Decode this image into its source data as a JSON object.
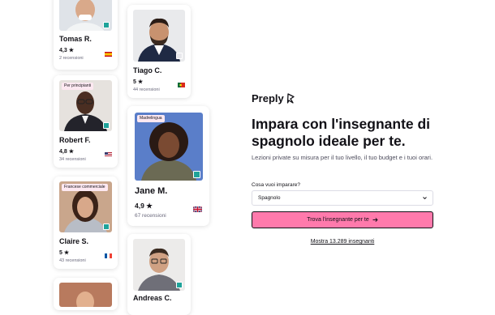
{
  "brand": {
    "name": "Preply"
  },
  "hero": {
    "headline": "Impara con l'insegnante di spagnolo ideale per te.",
    "subtext": "Lezioni private su misura per il tuo livello, il tuo budget e i tuoi orari."
  },
  "form": {
    "question": "Cosa vuoi imparare?",
    "selected": "Spagnolo",
    "cta_label": "Trova l'insegnante per te",
    "show_more": "Mostra 13.289 insegnanti"
  },
  "tutors": [
    {
      "name": "Tomas R.",
      "rating": "4,3",
      "reviews": "2 recensioni",
      "flag": "spain"
    },
    {
      "name": "Tiago C.",
      "rating": "5",
      "reviews": "44 recensioni",
      "flag": "portugal"
    },
    {
      "name": "Robert F.",
      "rating": "4,8",
      "reviews": "34 recensioni",
      "flag": "usa",
      "badge": "Per principianti"
    },
    {
      "name": "Jane M.",
      "rating": "4,9",
      "reviews": "67 recensioni",
      "flag": "uk",
      "badge": "Madrelingua"
    },
    {
      "name": "Claire S.",
      "rating": "5",
      "reviews": "43 recensioni",
      "flag": "france",
      "badge": "Francese commerciale"
    },
    {
      "name": "Andreas C.",
      "rating": "",
      "reviews": "",
      "flag": ""
    }
  ],
  "colors": {
    "accent": "#ff7aac",
    "online": "#1fa39a",
    "badge_bg": "#fde8f1",
    "text": "#121117"
  }
}
